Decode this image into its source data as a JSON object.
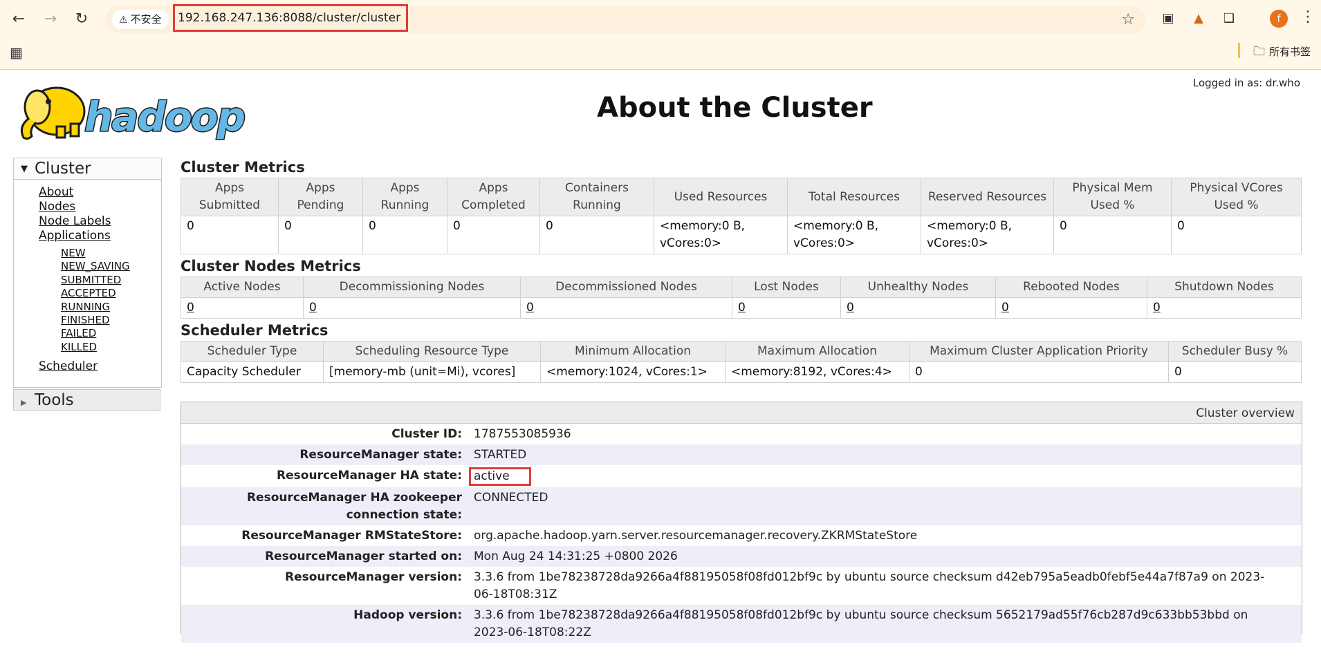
{
  "browser": {
    "security_label": "不安全",
    "url": "192.168.247.136:8088/cluster/cluster",
    "bookmark_folder": "所有书签",
    "profile_initial": "f"
  },
  "header": {
    "logo_text": "hadoop",
    "logged_in": "Logged in as: dr.who",
    "title": "About the Cluster"
  },
  "nav": {
    "cluster_label": "Cluster",
    "links": [
      "About",
      "Nodes",
      "Node Labels",
      "Applications"
    ],
    "app_states": [
      "NEW",
      "NEW_SAVING",
      "SUBMITTED",
      "ACCEPTED",
      "RUNNING",
      "FINISHED",
      "FAILED",
      "KILLED"
    ],
    "scheduler": "Scheduler",
    "tools_label": "Tools"
  },
  "cluster_metrics": {
    "title": "Cluster Metrics",
    "headers": [
      "Apps Submitted",
      "Apps Pending",
      "Apps Running",
      "Apps Completed",
      "Containers Running",
      "Used Resources",
      "Total Resources",
      "Reserved Resources",
      "Physical Mem Used %",
      "Physical VCores Used %"
    ],
    "values": [
      "0",
      "0",
      "0",
      "0",
      "0",
      "<memory:0 B, vCores:0>",
      "<memory:0 B, vCores:0>",
      "<memory:0 B, vCores:0>",
      "0",
      "0"
    ]
  },
  "node_metrics": {
    "title": "Cluster Nodes Metrics",
    "headers": [
      "Active Nodes",
      "Decommissioning Nodes",
      "Decommissioned Nodes",
      "Lost Nodes",
      "Unhealthy Nodes",
      "Rebooted Nodes",
      "Shutdown Nodes"
    ],
    "values": [
      "0",
      "0",
      "0",
      "0",
      "0",
      "0",
      "0"
    ]
  },
  "scheduler_metrics": {
    "title": "Scheduler Metrics",
    "headers": [
      "Scheduler Type",
      "Scheduling Resource Type",
      "Minimum Allocation",
      "Maximum Allocation",
      "Maximum Cluster Application Priority",
      "Scheduler Busy %"
    ],
    "values": [
      "Capacity Scheduler",
      "[memory-mb (unit=Mi), vcores]",
      "<memory:1024, vCores:1>",
      "<memory:8192, vCores:4>",
      "0",
      "0"
    ]
  },
  "overview": {
    "title": "Cluster overview",
    "rows": [
      {
        "key": "Cluster ID:",
        "value": "1787553085936"
      },
      {
        "key": "ResourceManager state:",
        "value": "STARTED"
      },
      {
        "key": "ResourceManager HA state:",
        "value": "active"
      },
      {
        "key": "ResourceManager HA zookeeper connection state:",
        "value": "CONNECTED"
      },
      {
        "key": "ResourceManager RMStateStore:",
        "value": "org.apache.hadoop.yarn.server.resourcemanager.recovery.ZKRMStateStore"
      },
      {
        "key": "ResourceManager started on:",
        "value": "Mon Aug 24 14:31:25 +0800 2026"
      },
      {
        "key": "ResourceManager version:",
        "value": "3.3.6 from 1be78238728da9266a4f88195058f08fd012bf9c by ubuntu source checksum d42eb795a5eadb0febf5e44a7f87a9 on 2023-06-18T08:31Z"
      },
      {
        "key": "Hadoop version:",
        "value": "3.3.6 from 1be78238728da9266a4f88195058f08fd012bf9c by ubuntu source checksum 5652179ad55f76cb287d9c633bb53bbd on 2023-06-18T08:22Z"
      }
    ]
  },
  "icons": {
    "back": "arrow-left-icon",
    "forward": "arrow-right-icon",
    "reload": "reload-icon",
    "warning": "warning-icon",
    "bookmark_star": "star-icon",
    "apps": "grid-icon",
    "folder": "folder-icon"
  },
  "colors": {
    "highlight_box": "#e03b3b",
    "chrome_bg": "#fff7e8",
    "logo_yellow": "#ffd400",
    "logo_blue": "#65b8e6"
  }
}
